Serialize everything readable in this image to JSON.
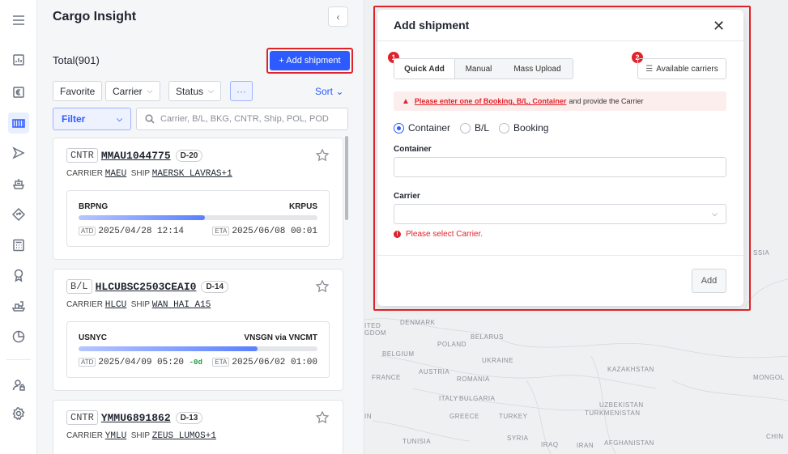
{
  "app": {
    "title": "Cargo Insight",
    "collapse_icon": "‹"
  },
  "rail": {
    "icons": [
      "menu-icon",
      "dashboard-icon",
      "euro-icon",
      "container-icon",
      "location-arrow-icon",
      "ship-icon",
      "route-icon",
      "calculator-icon",
      "badge-icon",
      "cargo-ship-icon",
      "pie-chart-icon",
      "user-lock-icon",
      "settings-icon"
    ],
    "active_index": 3
  },
  "list": {
    "total_label": "Total(901)",
    "add_button": "+ Add shipment",
    "chips": {
      "favorite": "Favorite",
      "carrier": "Carrier",
      "status": "Status",
      "more": "···"
    },
    "sort": "Sort ⌄",
    "filter": "Filter",
    "search_placeholder": "Carrier, B/L, BKG, CNTR, Ship, POL, POD",
    "cards": [
      {
        "type": "CNTR",
        "id": "MMAU1044775",
        "dday": "D-20",
        "carrier_label": "CARRIER",
        "carrier": "MAEU",
        "ship_label": "SHIP",
        "ship": "MAERSK LAVRAS+1",
        "pol": "BRPNG",
        "pod": "KRPUS",
        "progress": 0.53,
        "atd_label": "ATD",
        "atd": "2025/04/28 12:14",
        "delay": "",
        "eta_label": "ETA",
        "eta": "2025/06/08 00:01"
      },
      {
        "type": "B/L",
        "id": "HLCUBSC2503CEAI0",
        "dday": "D-14",
        "carrier_label": "CARRIER",
        "carrier": "HLCU",
        "ship_label": "SHIP",
        "ship": "WAN HAI A15",
        "pol": "USNYC",
        "pod": "VNSGN via VNCMT",
        "progress": 0.75,
        "atd_label": "ATD",
        "atd": "2025/04/09 05:20",
        "delay": "-0d",
        "eta_label": "ETA",
        "eta": "2025/06/02 01:00"
      },
      {
        "type": "CNTR",
        "id": "YMMU6891862",
        "dday": "D-13",
        "carrier_label": "CARRIER",
        "carrier": "YMLU",
        "ship_label": "SHIP",
        "ship": "ZEUS LUMOS+1"
      }
    ]
  },
  "map": {
    "labels": [
      "DENMARK",
      "BELARUS",
      "POLAND",
      "BELGIUM",
      "UKRAINE",
      "FRANCE",
      "AUSTRIA",
      "ROMANIA",
      "KAZAKHSTAN",
      "MONGOL",
      "ITALY",
      "BULGARIA",
      "UZBEKISTAN",
      "TURKMENISTAN",
      "GREECE",
      "TURKEY",
      "TUNISIA",
      "SYRIA",
      "IRAQ",
      "IRAN",
      "AFGHANISTAN",
      "CHIN",
      "SSIA",
      "ITED",
      "GDOM",
      "IN"
    ]
  },
  "modal": {
    "title": "Add shipment",
    "close_icon": "✕",
    "tabs": [
      "Quick Add",
      "Manual",
      "Mass Upload"
    ],
    "badge1": "1",
    "badge2": "2",
    "available_carriers": "Available carriers",
    "alert_link": "Please enter one of Booking, B/L, Container",
    "alert_rest": "and provide the Carrier",
    "radios": [
      "Container",
      "B/L",
      "Booking"
    ],
    "selected_radio": "Container",
    "container_label": "Container",
    "container_value": "",
    "carrier_label": "Carrier",
    "carrier_value": "",
    "error": "Please select Carrier.",
    "submit": "Add"
  }
}
